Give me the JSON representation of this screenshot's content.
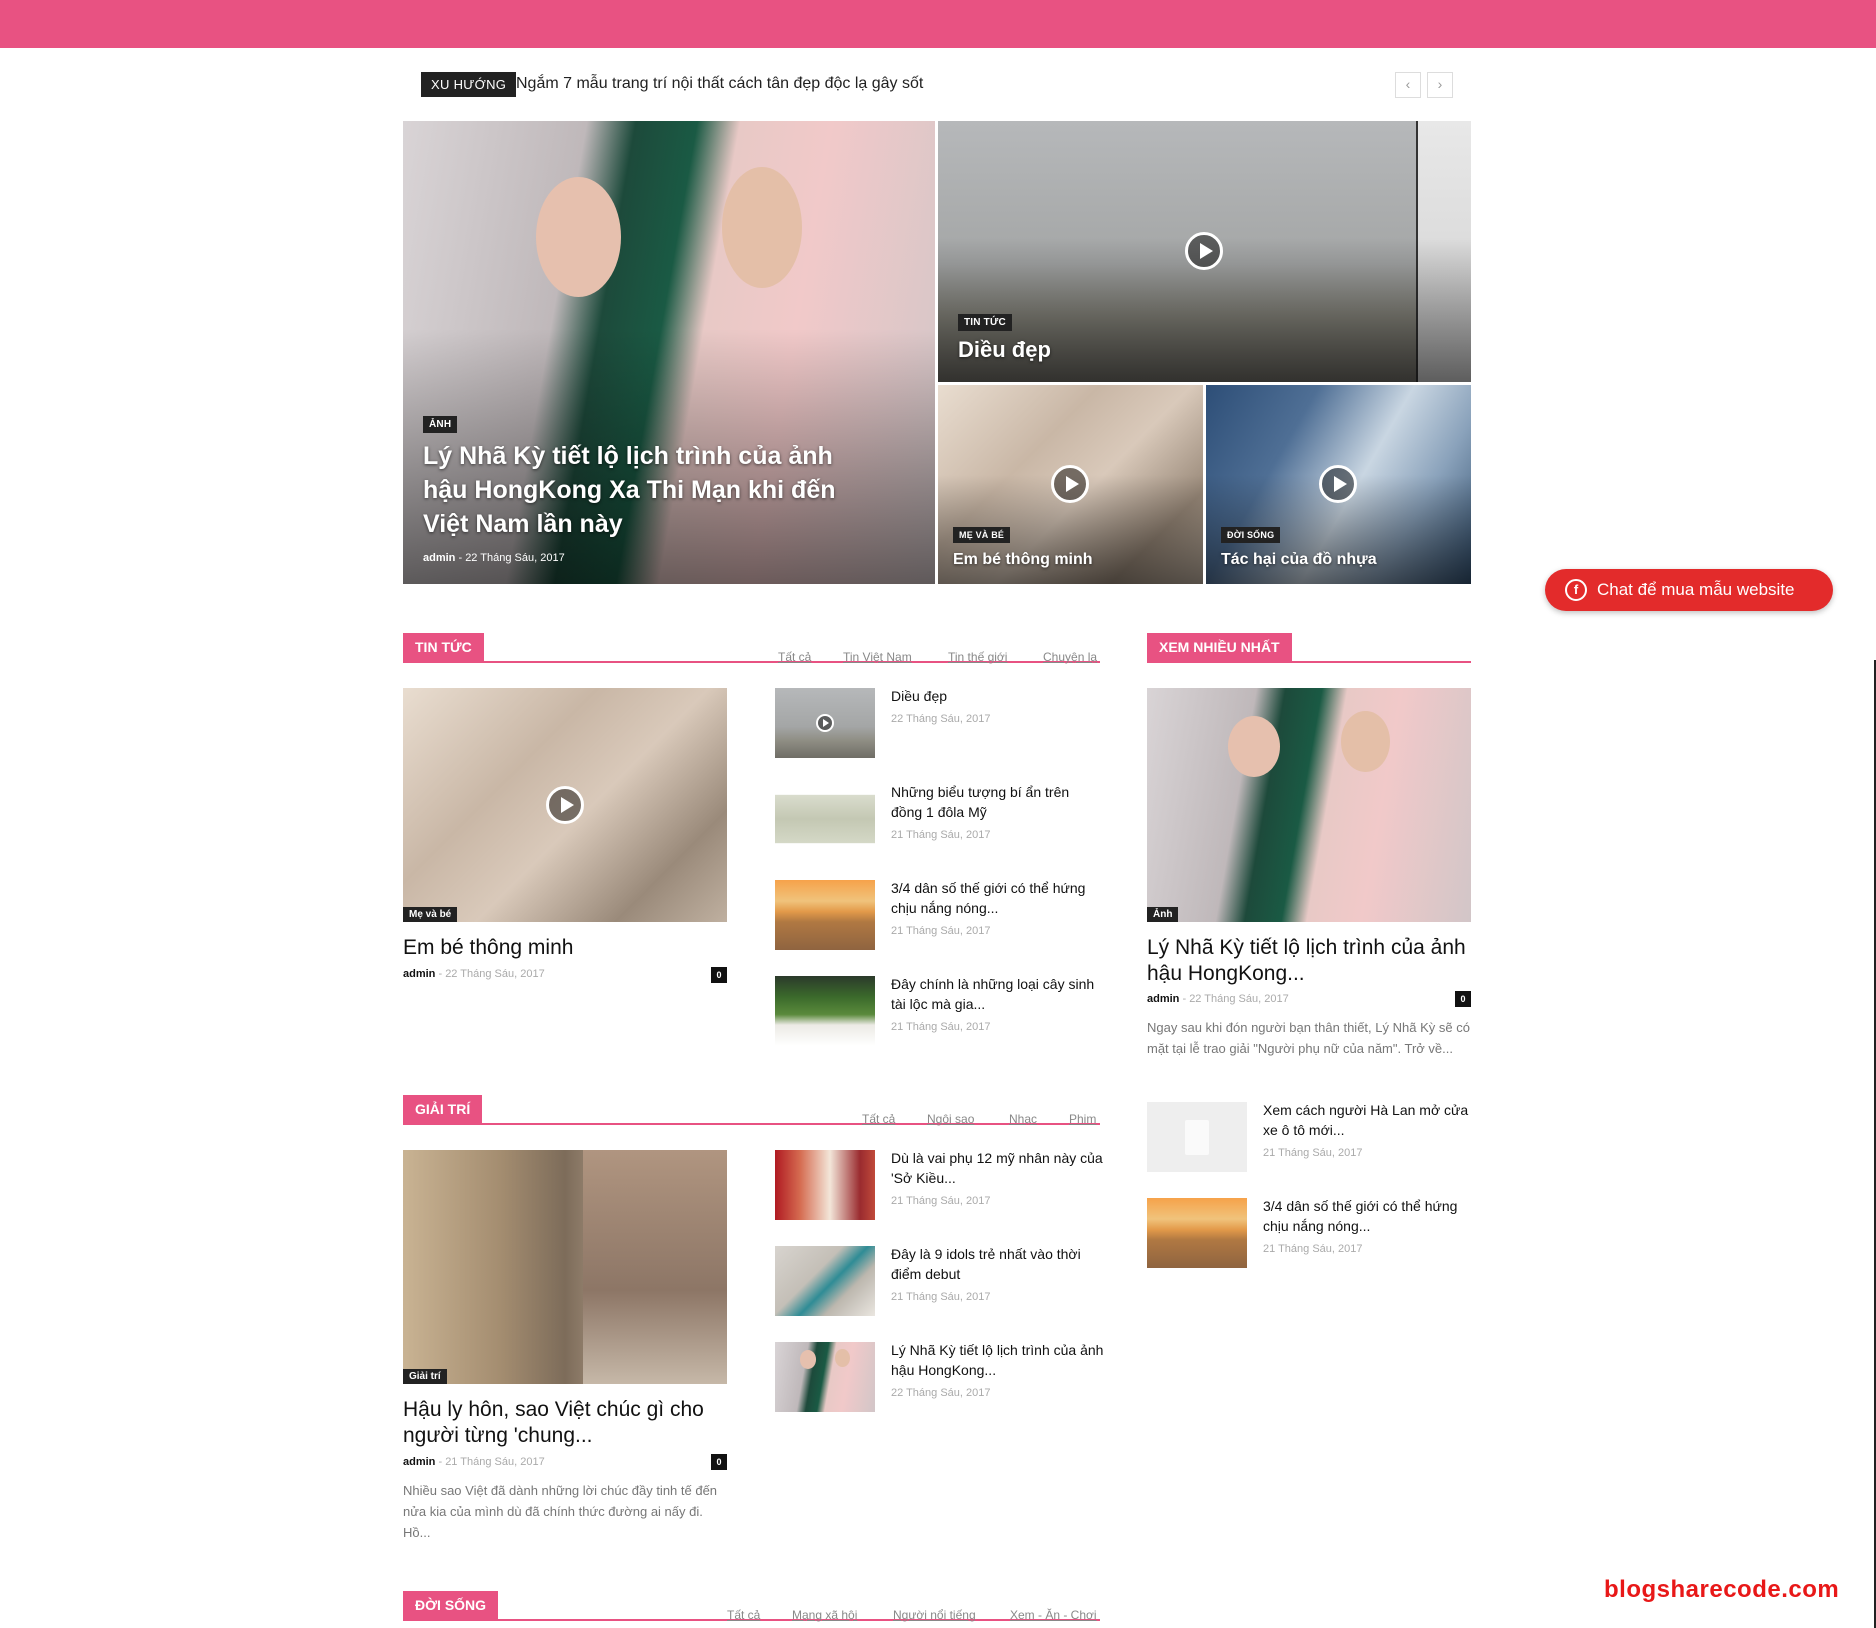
{
  "ticker": {
    "label": "XU HƯỚNG",
    "headline": "Ngắm 7 mẫu trang trí nội thất cách tân đẹp độc lạ gây sốt",
    "prev_icon": "‹",
    "next_icon": "›"
  },
  "hero": {
    "main": {
      "category": "ẢNH",
      "title": "Lý Nhã Kỳ tiết lộ lịch trình của ảnh hậu HongKong Xa Thi Mạn khi đến Việt Nam lần này",
      "author": "admin",
      "date": "22 Tháng Sáu, 2017"
    },
    "top_right": {
      "category": "TIN TỨC",
      "title": "Diều đẹp"
    },
    "bottom_left": {
      "category": "MẸ VÀ BÉ",
      "title": "Em bé thông minh"
    },
    "bottom_right": {
      "category": "ĐỜI SỐNG",
      "title": "Tác hại của đồ nhựa"
    }
  },
  "tin_tuc": {
    "label": "TIN TỨC",
    "tabs": [
      "Tất cả",
      "Tin Việt Nam",
      "Tin thế giới",
      "Chuyện lạ"
    ],
    "featured": {
      "category": "Mẹ và bé",
      "title": "Em bé thông minh",
      "author": "admin",
      "date": "22 Tháng Sáu, 2017",
      "comments": "0"
    },
    "items": [
      {
        "title": "Diều đẹp",
        "date": "22 Tháng Sáu, 2017"
      },
      {
        "title": "Những biểu tượng bí ẩn trên đồng 1 đôla Mỹ",
        "date": "21 Tháng Sáu, 2017"
      },
      {
        "title": "3/4 dân số thế giới có thể hứng chịu nắng nóng...",
        "date": "21 Tháng Sáu, 2017"
      },
      {
        "title": "Đây chính là những loại cây sinh tài lộc mà gia...",
        "date": "21 Tháng Sáu, 2017"
      }
    ]
  },
  "giai_tri": {
    "label": "GIẢI TRÍ",
    "tabs": [
      "Tất cả",
      "Ngôi sao",
      "Nhạc",
      "Phim"
    ],
    "featured": {
      "category": "Giải trí",
      "title": "Hậu ly hôn, sao Việt chúc gì cho người từng 'chung...",
      "author": "admin",
      "date": "21 Tháng Sáu, 2017",
      "comments": "0",
      "excerpt": "Nhiều sao Việt đã dành những lời chúc đầy tinh tế đến nửa kia của mình dù đã chính thức đường ai nấy đi. Hồ..."
    },
    "items": [
      {
        "title": "Dù là vai phụ 12 mỹ nhân này của 'Sở Kiều...",
        "date": "21 Tháng Sáu, 2017"
      },
      {
        "title": "Đây là 9 idols trẻ nhất vào thời điểm debut",
        "date": "21 Tháng Sáu, 2017"
      },
      {
        "title": "Lý Nhã Kỳ tiết lộ lịch trình của ảnh hậu HongKong...",
        "date": "22 Tháng Sáu, 2017"
      }
    ]
  },
  "xem_nhieu": {
    "label": "XEM NHIỀU NHẤT",
    "featured": {
      "category": "Ảnh",
      "title": "Lý Nhã Kỳ tiết lộ lịch trình của ảnh hậu HongKong...",
      "author": "admin",
      "date": "22 Tháng Sáu, 2017",
      "comments": "0",
      "excerpt": "Ngay sau khi đón người bạn thân thiết, Lý Nhã Kỳ sẽ có mặt tại lễ trao giải \"Người phụ nữ của năm\". Trở về..."
    },
    "items": [
      {
        "title": "Xem cách người Hà Lan mở cửa xe ô tô mới...",
        "date": "21 Tháng Sáu, 2017"
      },
      {
        "title": "3/4 dân số thế giới có thể hứng chịu nắng nóng...",
        "date": "21 Tháng Sáu, 2017"
      }
    ]
  },
  "doi_song": {
    "label": "ĐỜI SỐNG",
    "tabs": [
      "Tất cả",
      "Mạng xã hội",
      "Người nổi tiếng",
      "Xem - Ăn - Chơi"
    ]
  },
  "chat": {
    "text": "Chat để mua mẫu website",
    "icon": "messenger-icon"
  },
  "watermark": "blogsharecode.com",
  "colors": {
    "accent": "#e85282",
    "chat_button": "#e32b2b",
    "watermark": "#e81818"
  }
}
